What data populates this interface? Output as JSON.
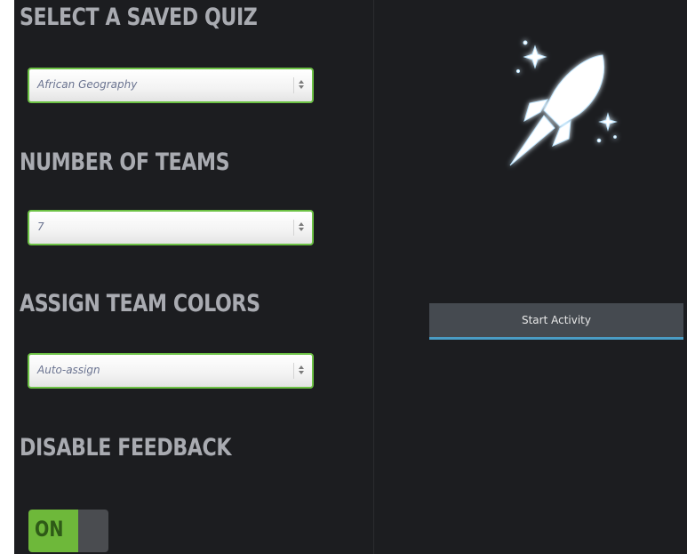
{
  "sections": {
    "saved_quiz": {
      "heading": "SELECT A SAVED QUIZ",
      "selected": "African Geography"
    },
    "number_of_teams": {
      "heading": "NUMBER OF TEAMS",
      "selected": "7"
    },
    "team_colors": {
      "heading": "ASSIGN TEAM COLORS",
      "selected": "Auto-assign"
    },
    "disable_feedback": {
      "heading": "DISABLE FEEDBACK",
      "toggle_label": "ON",
      "toggle_state": "on"
    }
  },
  "action": {
    "start_label": "Start Activity"
  },
  "icons": {
    "hero": "rocket-icon",
    "select_arrows": "updown-chevron-icon"
  },
  "colors": {
    "panel_bg": "#1c1d20",
    "heading_text": "#a9abb1",
    "select_border": "#6cc144",
    "toggle_on": "#6eb83a",
    "button_bg": "#454a50",
    "button_accent": "#4a9cc4"
  }
}
